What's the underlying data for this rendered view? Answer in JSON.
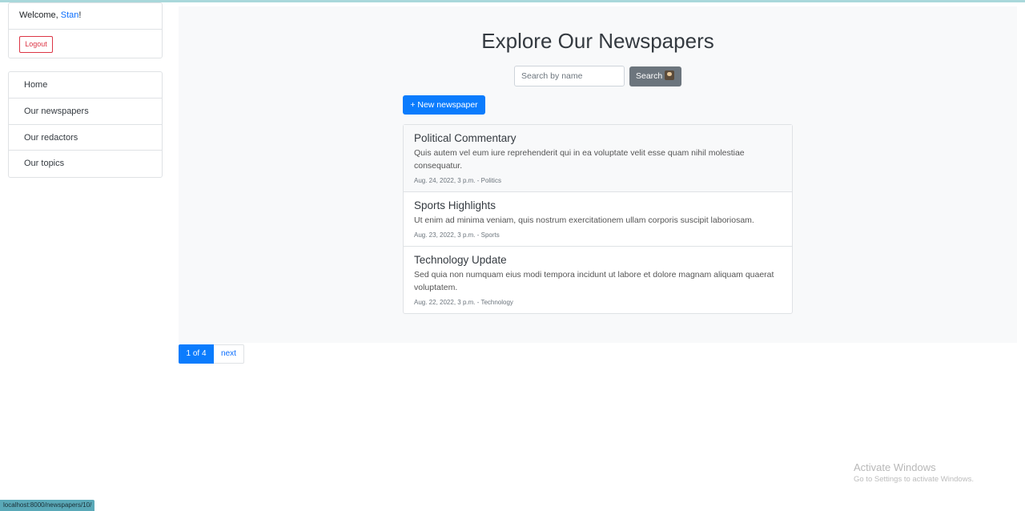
{
  "sidebar": {
    "welcome_prefix": "Welcome, ",
    "username": "Stan",
    "welcome_suffix": "!",
    "logout_label": "Logout",
    "nav": [
      {
        "label": "Home"
      },
      {
        "label": "Our newspapers"
      },
      {
        "label": "Our redactors"
      },
      {
        "label": "Our topics"
      }
    ]
  },
  "main": {
    "title": "Explore Our Newspapers",
    "search": {
      "placeholder": "Search by name",
      "button_label": "Search"
    },
    "new_button_label": "+ New newspaper",
    "items": [
      {
        "title": "Political Commentary",
        "body": "Quis autem vel eum iure reprehenderit qui in ea voluptate velit esse quam nihil molestiae consequatur.",
        "meta": "Aug. 24, 2022, 3 p.m. - Politics"
      },
      {
        "title": "Sports Highlights",
        "body": "Ut enim ad minima veniam, quis nostrum exercitationem ullam corporis suscipit laboriosam.",
        "meta": "Aug. 23, 2022, 3 p.m. - Sports"
      },
      {
        "title": "Technology Update",
        "body": "Sed quia non numquam eius modi tempora incidunt ut labore et dolore magnam aliquam quaerat voluptatem.",
        "meta": "Aug. 22, 2022, 3 p.m. - Technology"
      }
    ]
  },
  "pagination": {
    "current": "1 of 4",
    "next": "next"
  },
  "watermark": {
    "title": "Activate Windows",
    "subtitle": "Go to Settings to activate Windows."
  },
  "status_url": "localhost:8000/newspapers/10/",
  "colors": {
    "primary": "#0b7cfd",
    "danger": "#dc3545",
    "secondary": "#6c757d",
    "panel": "#f8f9fa"
  }
}
